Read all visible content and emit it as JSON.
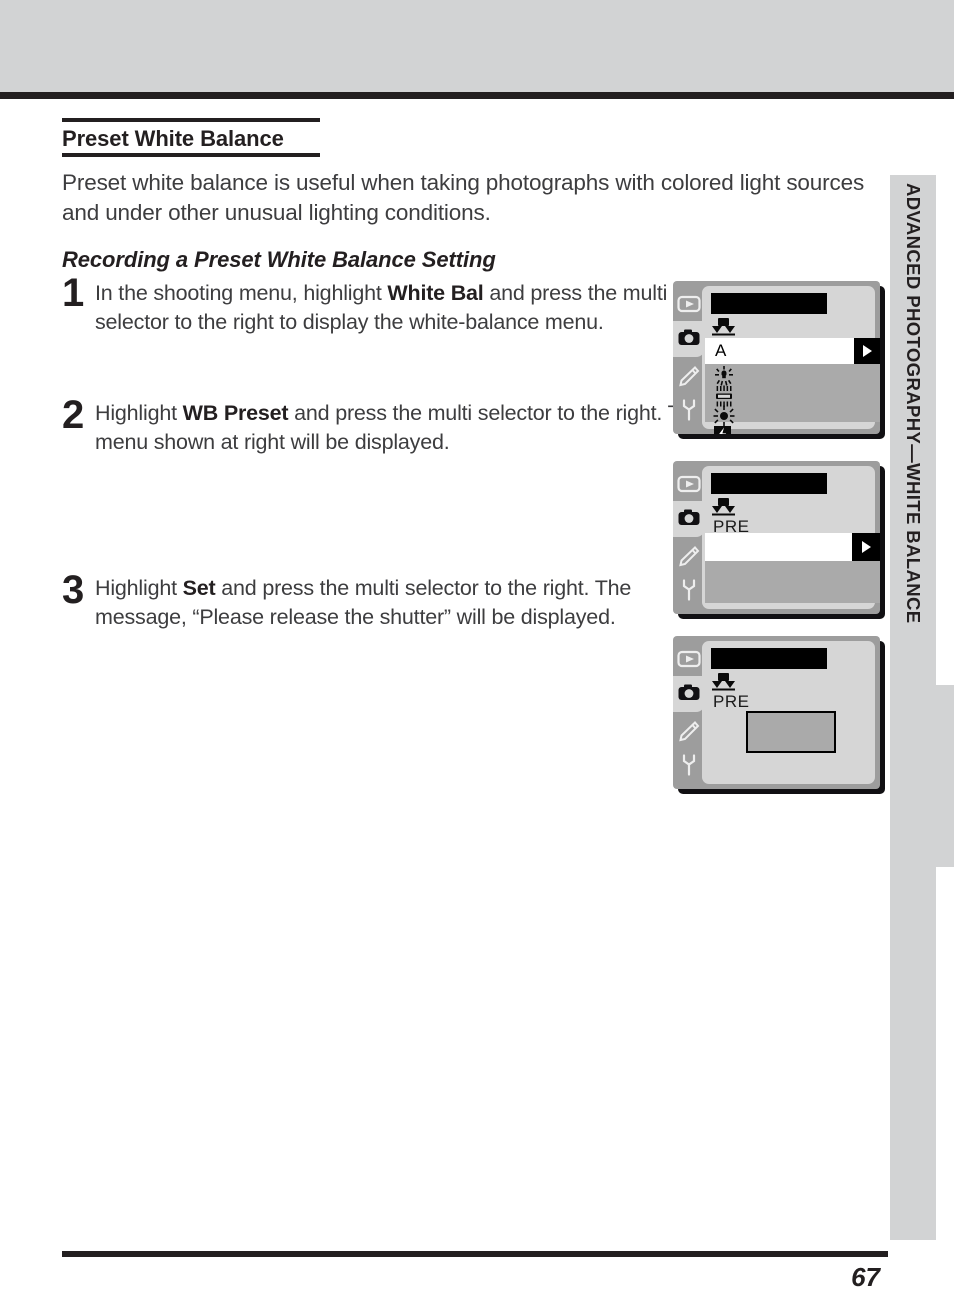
{
  "running_head": "ADVANCED PHOTOGRAPHY—WHITE BALANCE",
  "page_number": "67",
  "section": {
    "title": "Preset White Balance",
    "intro": "Preset white balance is useful when taking photographs with colored light sources and under other unusual lighting conditions.",
    "subhead": "Recording a Preset White Balance Setting"
  },
  "steps": [
    {
      "number": "1",
      "text_before": "In the shooting menu, highlight ",
      "bold": "White Bal",
      "text_after": " and press the multi selector to the right to display the white-balance menu."
    },
    {
      "number": "2",
      "text_before": "Highlight ",
      "bold": "WB Preset",
      "text_after": " and press the multi selector to the right.  The menu shown at right will be displayed."
    },
    {
      "number": "3",
      "text_before": "Highlight ",
      "bold": "Set",
      "text_after": " and press the multi selector to the right. The message, “Please release the shutter” will be displayed."
    }
  ],
  "lcd_screens": [
    {
      "id": "white-balance-menu",
      "title_bar": "",
      "tabs": [
        "playback-tab-icon",
        "shooting-tab-icon",
        "custom-settings-tab-icon",
        "setup-tab-icon"
      ],
      "selected_tab": "shooting-tab-icon",
      "selected_row_label": "A",
      "options": [
        "auto-wb-icon",
        "incandescent-icon",
        "fluorescent-icon",
        "direct-sunlight-icon",
        "flash-icon"
      ]
    },
    {
      "id": "wb-preset-menu",
      "title_bar": "",
      "tabs": [
        "playback-tab-icon",
        "shooting-tab-icon",
        "custom-settings-tab-icon",
        "setup-tab-icon"
      ],
      "selected_tab": "shooting-tab-icon",
      "mode_label": "PRE",
      "selected_row_label": ""
    },
    {
      "id": "wb-preset-message",
      "title_bar": "",
      "tabs": [
        "playback-tab-icon",
        "shooting-tab-icon",
        "custom-settings-tab-icon",
        "setup-tab-icon"
      ],
      "selected_tab": "shooting-tab-icon",
      "mode_label": "PRE",
      "message_box": ""
    }
  ],
  "colors": {
    "ink": "#231f20",
    "body_text": "#3d3d3f",
    "band_gray": "#d2d3d4",
    "lcd_bezel": "#9d9d9d",
    "lcd_screen": "#d6d6d6",
    "lcd_row_selected": "#ffffff",
    "lcd_list_bg": "#aaaaaa"
  }
}
